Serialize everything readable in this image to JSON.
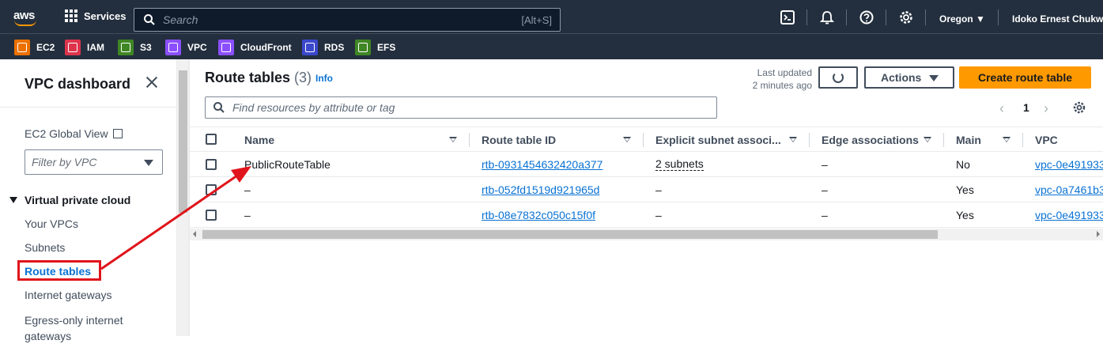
{
  "topnav": {
    "logo": "aws",
    "services_label": "Services",
    "search_placeholder": "Search",
    "search_shortcut": "[Alt+S]",
    "region": "Oregon ▼",
    "user": "Idoko Ernest Chukwu"
  },
  "favorites": [
    {
      "label": "EC2",
      "color": "#ed7100"
    },
    {
      "label": "IAM",
      "color": "#dd344c"
    },
    {
      "label": "S3",
      "color": "#3f8624"
    },
    {
      "label": "VPC",
      "color": "#8c4fff"
    },
    {
      "label": "CloudFront",
      "color": "#8c4fff"
    },
    {
      "label": "RDS",
      "color": "#3b48cc"
    },
    {
      "label": "EFS",
      "color": "#3f8624"
    }
  ],
  "sidebar": {
    "title": "VPC dashboard",
    "ec2_global_view": "EC2 Global View",
    "filter_placeholder": "Filter by VPC",
    "section": "Virtual private cloud",
    "items": [
      {
        "label": "Your VPCs"
      },
      {
        "label": "Subnets"
      },
      {
        "label": "Route tables"
      },
      {
        "label": "Internet gateways"
      },
      {
        "label": "Egress-only internet gateways"
      }
    ]
  },
  "main": {
    "title": "Route tables",
    "count": "(3)",
    "info": "Info",
    "last_updated_line1": "Last updated",
    "last_updated_line2": "2 minutes ago",
    "actions_label": "Actions",
    "create_label": "Create route table",
    "search_placeholder": "Find resources by attribute or tag",
    "page": "1"
  },
  "table": {
    "columns": [
      "Name",
      "Route table ID",
      "Explicit subnet associ...",
      "Edge associations",
      "Main",
      "VPC"
    ],
    "rows": [
      {
        "name": "PublicRouteTable",
        "id": "rtb-0931454632420a377",
        "subnet": "2 subnets",
        "edge": "–",
        "main": "No",
        "vpc": "vpc-0e491933"
      },
      {
        "name": "–",
        "id": "rtb-052fd1519d921965d",
        "subnet": "–",
        "edge": "–",
        "main": "Yes",
        "vpc": "vpc-0a7461b3"
      },
      {
        "name": "–",
        "id": "rtb-08e7832c050c15f0f",
        "subnet": "–",
        "edge": "–",
        "main": "Yes",
        "vpc": "vpc-0e491933"
      }
    ]
  },
  "annotation": {
    "color": "#e0151b"
  }
}
